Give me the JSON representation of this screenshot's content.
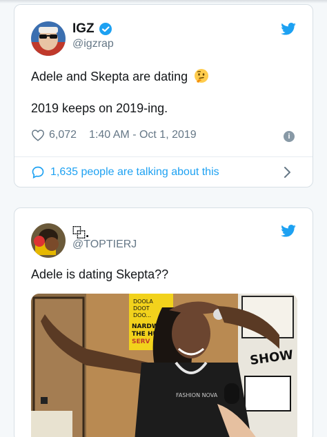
{
  "tweets": [
    {
      "display_name": "IGZ",
      "handle": "@igzrap",
      "lines": [
        "Adele and Skepta are dating",
        "2019 keeps on 2019-ing."
      ],
      "emoji": "thinking-face",
      "likes": "6,072",
      "timestamp": "1:40 AM - Oct 1, 2019",
      "talking": "1,635 people are talking about this",
      "verified": true
    },
    {
      "display_name": "⿻.",
      "handle": "@TOPTIERJ",
      "lines": [
        "Adele is dating Skepta??"
      ],
      "photo_caption_sign": "DOOLA DOOT DOO... NARDWU THE HU SERV",
      "photo_right_sign": "SHOW"
    }
  ],
  "colors": {
    "accent": "#1da1f2",
    "muted": "#657786",
    "text": "#14171a"
  },
  "icons": [
    "twitter-bird-icon",
    "verified-badge-icon",
    "heart-icon",
    "info-icon",
    "speech-bubble-icon",
    "chevron-right-icon"
  ]
}
